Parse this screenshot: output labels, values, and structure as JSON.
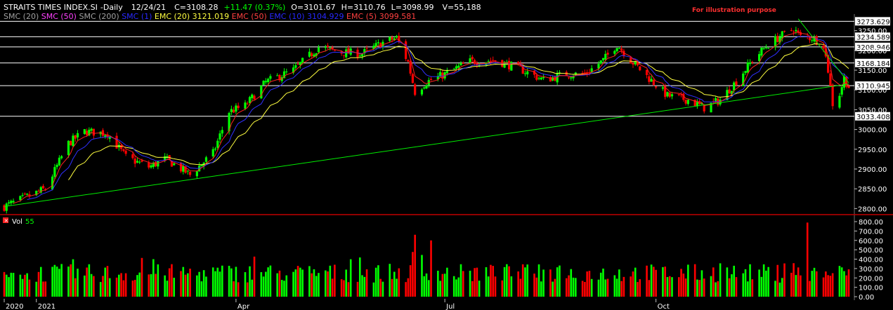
{
  "header": {
    "symbol": "STRAITS TIMES INDEX.SI",
    "interval": "-Daily",
    "date": "12/24/21",
    "close": "C=3108.28",
    "change": "+11.47 (0.37%)",
    "open": "O=3101.67",
    "high": "H=3110.76",
    "low": "L=3098.99",
    "volume": "V=55,188"
  },
  "indicators": [
    {
      "label": "SMC (20)",
      "color": "#a0a0a0"
    },
    {
      "label": "SMC (50)",
      "color": "#ff40ff"
    },
    {
      "label": "SMC (200)",
      "color": "#a0a0a0"
    },
    {
      "label": "SMC (1)",
      "color": "#2828ff"
    },
    {
      "label": "EMC (20)",
      "color": "#ffff40"
    },
    {
      "label": "3121.019",
      "color": "#ffff40"
    },
    {
      "label": "EMC (50)",
      "color": "#ff4040"
    },
    {
      "label": "EMC (10)",
      "color": "#2828ff"
    },
    {
      "label": "3104.929",
      "color": "#2828ff"
    },
    {
      "label": "EMC (5)",
      "color": "#ff4040"
    },
    {
      "label": "3099.581",
      "color": "#ff4040"
    }
  ],
  "annotation": "For illustration purpose",
  "volume_header": {
    "label": "Vol",
    "value": "55"
  },
  "colors": {
    "up": "#00ff00",
    "down": "#ff0000",
    "ema5": "#ff2020",
    "ema10": "#3030ff",
    "ema20": "#ffff40",
    "trend": "#00ee00",
    "level": "#ffffff"
  },
  "chart_data": [
    {
      "type": "candlestick",
      "title": "STRAITS TIMES INDEX.SI -Daily",
      "x_labels": [
        "2020",
        "2021",
        "Apr",
        "Jul",
        "Oct"
      ],
      "ylim": [
        2790,
        3292
      ],
      "y_ticks": [
        2800,
        2850,
        2900,
        2950,
        3000,
        3050,
        3100,
        3150,
        3200,
        3250
      ],
      "y_tick_labels": [
        "2800.00",
        "2850.00",
        "2900.00",
        "2950.00",
        "3000.00",
        "3050.00",
        "3100.00",
        "3150.00",
        "3200.00",
        "3250.00"
      ],
      "horizontal_levels": [
        {
          "value": 3273.629,
          "label": "3273.629"
        },
        {
          "value": 3234.589,
          "label": "3234.589"
        },
        {
          "value": 3208.946,
          "label": "3208.946"
        },
        {
          "value": 3168.184,
          "label": "3168.184"
        },
        {
          "value": 3110.945,
          "label": "3110.945"
        },
        {
          "value": 3033.408,
          "label": "3033.408"
        }
      ],
      "series_anchors": [
        [
          "2020-12-21",
          2805
        ],
        [
          "2021-01-08",
          2850
        ],
        [
          "2021-01-18",
          2965
        ],
        [
          "2021-01-25",
          2995
        ],
        [
          "2021-02-04",
          2990
        ],
        [
          "2021-02-12",
          2930
        ],
        [
          "2021-02-22",
          2905
        ],
        [
          "2021-03-01",
          2925
        ],
        [
          "2021-03-05",
          2912
        ],
        [
          "2021-03-12",
          2885
        ],
        [
          "2021-03-22",
          2940
        ],
        [
          "2021-03-29",
          3045
        ],
        [
          "2021-04-05",
          3060
        ],
        [
          "2021-04-14",
          3120
        ],
        [
          "2021-04-26",
          3150
        ],
        [
          "2021-05-07",
          3208
        ],
        [
          "2021-05-17",
          3195
        ],
        [
          "2021-05-26",
          3192
        ],
        [
          "2021-06-04",
          3220
        ],
        [
          "2021-06-10",
          3232
        ],
        [
          "2021-06-15",
          3170
        ],
        [
          "2021-06-18",
          3095
        ],
        [
          "2021-06-23",
          3120
        ],
        [
          "2021-07-01",
          3140
        ],
        [
          "2021-07-12",
          3172
        ],
        [
          "2021-07-23",
          3175
        ],
        [
          "2021-08-02",
          3155
        ],
        [
          "2021-08-13",
          3125
        ],
        [
          "2021-08-23",
          3140
        ],
        [
          "2021-08-31",
          3140
        ],
        [
          "2021-09-08",
          3175
        ],
        [
          "2021-09-14",
          3215
        ],
        [
          "2021-09-20",
          3175
        ],
        [
          "2021-09-27",
          3135
        ],
        [
          "2021-10-06",
          3085
        ],
        [
          "2021-10-15",
          3075
        ],
        [
          "2021-10-22",
          3055
        ],
        [
          "2021-10-29",
          3075
        ],
        [
          "2021-11-04",
          3115
        ],
        [
          "2021-11-12",
          3175
        ],
        [
          "2021-11-18",
          3210
        ],
        [
          "2021-11-24",
          3235
        ],
        [
          "2021-11-30",
          3255
        ],
        [
          "2021-12-03",
          3234
        ],
        [
          "2021-12-08",
          3232
        ],
        [
          "2021-12-13",
          3215
        ],
        [
          "2021-12-15",
          3150
        ],
        [
          "2021-12-17",
          3065
        ],
        [
          "2021-12-20",
          3090
        ],
        [
          "2021-12-22",
          3130
        ],
        [
          "2021-12-24",
          3108
        ]
      ],
      "trendlines": [
        {
          "name": "support",
          "from": [
            "2020-12-21",
            2805
          ],
          "to": [
            "2021-12-24",
            3115
          ]
        },
        {
          "name": "resistance",
          "from": [
            "2021-12-02",
            3280
          ],
          "to": [
            "2021-12-24",
            3118
          ]
        }
      ]
    },
    {
      "type": "bar",
      "title": "Vol",
      "ylim": [
        0,
        800
      ],
      "y_ticks": [
        0,
        100,
        200,
        300,
        400,
        500,
        600,
        700,
        800
      ],
      "y_tick_labels": [
        "0.00",
        "100.00",
        "200.00",
        "300.00",
        "400.00",
        "500.00",
        "600.00",
        "700.00",
        "800.00"
      ],
      "spikes": [
        {
          "date": "2021-06-18",
          "value": 660
        },
        {
          "date": "2021-06-25",
          "value": 600
        },
        {
          "date": "2021-12-06",
          "value": 790
        }
      ]
    }
  ]
}
